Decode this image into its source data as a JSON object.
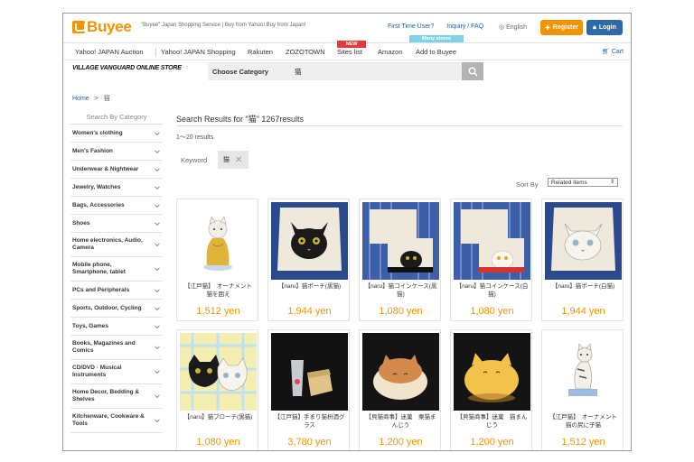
{
  "header": {
    "logo_text": "Buyee",
    "tagline": "\"Buyee\" Japan Shopping Service | Buy from Yahoo! Buy from Japan!",
    "links": [
      "First Time User?",
      "Inquiry / FAQ"
    ],
    "language": "English",
    "register_label": "Register",
    "login_label": "Login"
  },
  "nav": {
    "items": [
      "Yahoo! JAPAN Auction",
      "Yahoo! JAPAN Shopping",
      "Rakuten",
      "ZOZOTOWN",
      "Sites list",
      "Amazon",
      "Add to Buyee"
    ],
    "badge_new": "NEW",
    "badge_stores": "Many stores",
    "cart_label": "Cart"
  },
  "store": {
    "logo_text": "VILLAGE VANGUARD ONLINE STORE"
  },
  "search": {
    "category_label": "Choose Category",
    "query": "猫"
  },
  "breadcrumb": {
    "home": "Home",
    "sep": ">",
    "current": "猫"
  },
  "sidebar": {
    "heading": "Search By Category",
    "categories": [
      "Women's clothing",
      "Men's Fashion",
      "Underwear & Nightwear",
      "Jewelry, Watches",
      "Bags, Accessories",
      "Shoes",
      "Home electronics, Audio, Camera",
      "Mobile phone, Smartphone, tablet",
      "PCs and Peripherals",
      "Sports, Outdoor, Cycling",
      "Toys, Games",
      "Books, Magazines and Comics",
      "CD/DVD · Musical Instruments",
      "Home Decor, Bedding & Shelves",
      "Kitchenware, Cookware & Tools"
    ]
  },
  "results": {
    "title": "Search Results for \"猫\" 1267results",
    "range": "1～20 results",
    "keyword_label": "Keyword",
    "keyword_value": "猫",
    "sort_label": "Sort By",
    "sort_value": "Related items"
  },
  "products": [
    {
      "name": "【江戸猫】　オーナメント　猫を囲え",
      "price": "1,512 yen"
    },
    {
      "name": "【naru】猫ポーチ(黒猫)",
      "price": "1,944 yen"
    },
    {
      "name": "【naru】猫コインケース(黒猫)",
      "price": "1,080 yen"
    },
    {
      "name": "【naru】猫コインケース(白猫)",
      "price": "1,080 yen"
    },
    {
      "name": "【naru】猫ポーチ(白猫)",
      "price": "1,944 yen"
    },
    {
      "name": "【naru】猫ブローチ(黒猫)",
      "price": "1,080 yen"
    },
    {
      "name": "【江戸猫】手まり猫枡酒グラス",
      "price": "3,780 yen"
    },
    {
      "name": "【貝猫商事】迷菓　栗猫まんじう",
      "price": "1,200 yen"
    },
    {
      "name": "【貝猫商事】迷菓　猫まんじう",
      "price": "1,200 yen"
    },
    {
      "name": "【江戸猫】　オーナメント　猫の尻に子猫",
      "price": "1,512 yen"
    }
  ],
  "colors": {
    "accent": "#f29400",
    "link": "#1b5fa8",
    "login": "#2f6aa8",
    "new_badge": "#e03a3a",
    "stores_badge": "#7fd3e6"
  }
}
